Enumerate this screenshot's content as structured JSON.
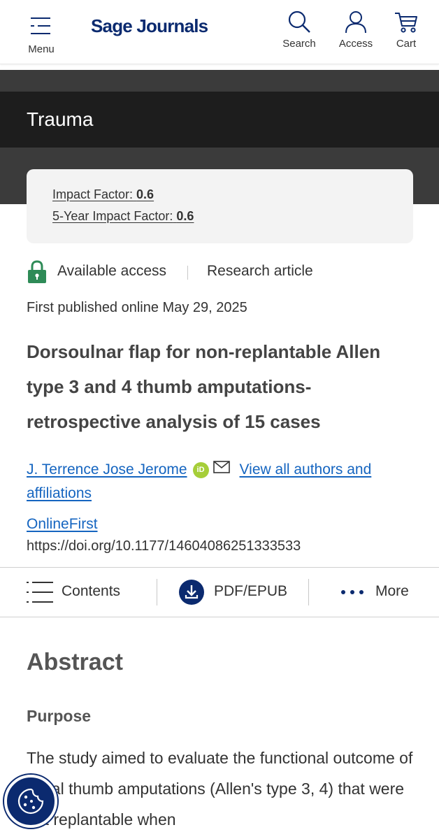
{
  "header": {
    "menu_label": "Menu",
    "logo": "Sage Journals",
    "search_label": "Search",
    "access_label": "Access",
    "cart_label": "Cart"
  },
  "journal": {
    "title": "Trauma",
    "impact_factor_label": "Impact Factor:",
    "impact_factor_value": "0.6",
    "five_year_label": "5-Year Impact Factor:",
    "five_year_value": "0.6"
  },
  "article": {
    "access": "Available access",
    "type": "Research article",
    "published": "First published online May 29, 2025",
    "title": "Dorsoulnar flap for non-replantable Allen type 3 and 4 thumb amputations- retrospective analysis of 15 cases",
    "author": "J. Terrence Jose Jerome",
    "orcid_text": "iD",
    "view_all": "View all authors and affiliations",
    "issue": "OnlineFirst",
    "doi": "https://doi.org/10.1177/14604086251333533"
  },
  "toolbar": {
    "contents": "Contents",
    "pdf": "PDF/EPUB",
    "more": "More"
  },
  "abstract": {
    "heading": "Abstract",
    "subheading": "Purpose",
    "text": "The study aimed to evaluate the functional outcome of distal thumb amputations (Allen's type 3, 4) that were not replantable when"
  },
  "colors": {
    "brand": "#0b2a6f",
    "link": "#1565c0",
    "access_green": "#2e8b57",
    "banner_dark": "#3b3b3b",
    "banner_black": "#1d1d1d",
    "orcid": "#a6ce39"
  },
  "icons": [
    "menu-icon",
    "search-icon",
    "user-icon",
    "cart-icon",
    "lock-icon",
    "orcid-icon",
    "mail-icon",
    "list-icon",
    "download-icon",
    "more-dots-icon",
    "cookie-icon"
  ]
}
